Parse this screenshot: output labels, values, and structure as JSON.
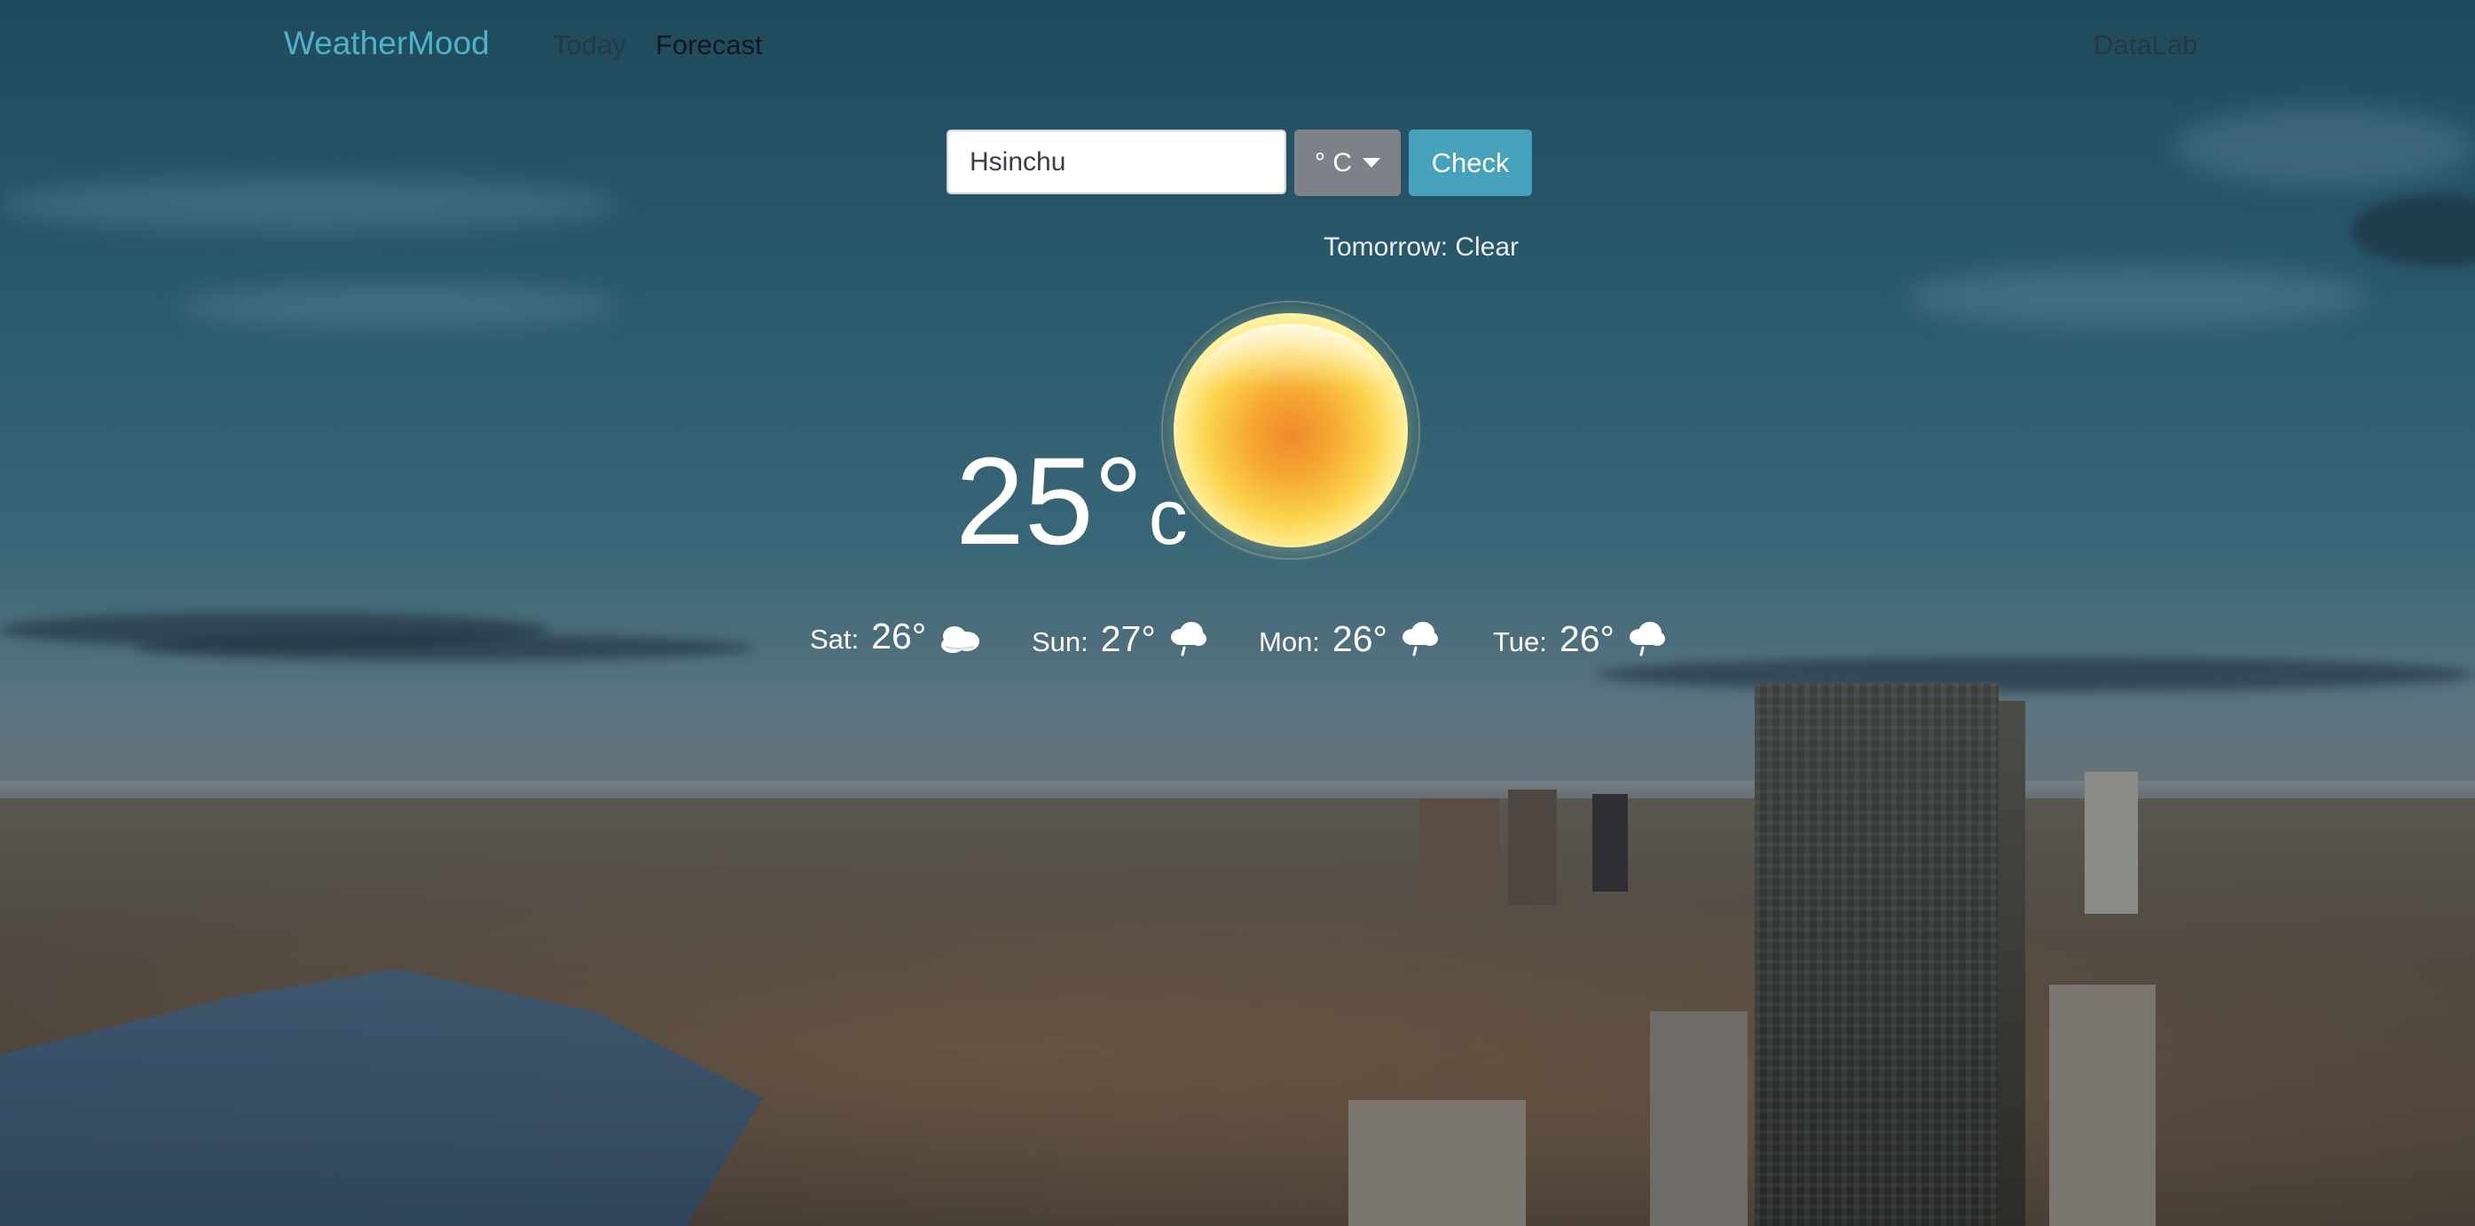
{
  "navbar": {
    "brand": "WeatherMood",
    "links": [
      {
        "label": "Today"
      },
      {
        "label": "Forecast"
      }
    ],
    "right_link": "DataLab"
  },
  "search": {
    "value": "Hsinchu",
    "unit_label": "° C",
    "check_label": "Check"
  },
  "current": {
    "tomorrow_text": "Tomorrow: Clear",
    "temperature": "25°",
    "unit": "c",
    "icon": "sun-icon"
  },
  "forecast": [
    {
      "day": "Sat:",
      "temp": "26°",
      "icon": "cloudy-icon"
    },
    {
      "day": "Sun:",
      "temp": "27°",
      "icon": "rain-cloud-icon"
    },
    {
      "day": "Mon:",
      "temp": "26°",
      "icon": "rain-cloud-icon"
    },
    {
      "day": "Tue:",
      "temp": "26°",
      "icon": "rain-cloud-icon"
    }
  ],
  "colors": {
    "brand": "#4fb3c8",
    "check_button": "#46a2ba",
    "unit_button": "#7c8288"
  }
}
